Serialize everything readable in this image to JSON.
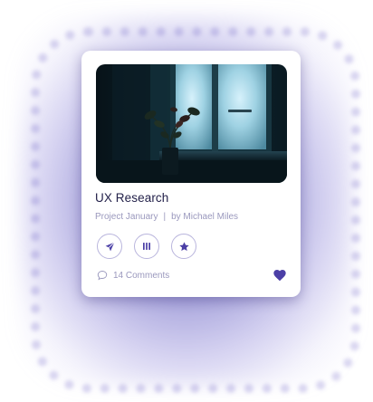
{
  "card": {
    "title": "UX Research",
    "project": "Project January",
    "separator": "|",
    "author": "by Michael Miles",
    "comments": "14 Comments",
    "actions": [
      {
        "icon": "send-icon"
      },
      {
        "icon": "columns-icon"
      },
      {
        "icon": "star-icon"
      }
    ],
    "like_icon": "heart-icon"
  },
  "colors": {
    "accent": "#4b3fa6",
    "title": "#23214a",
    "muted": "#9a98bd",
    "glow": "#5a50be"
  }
}
